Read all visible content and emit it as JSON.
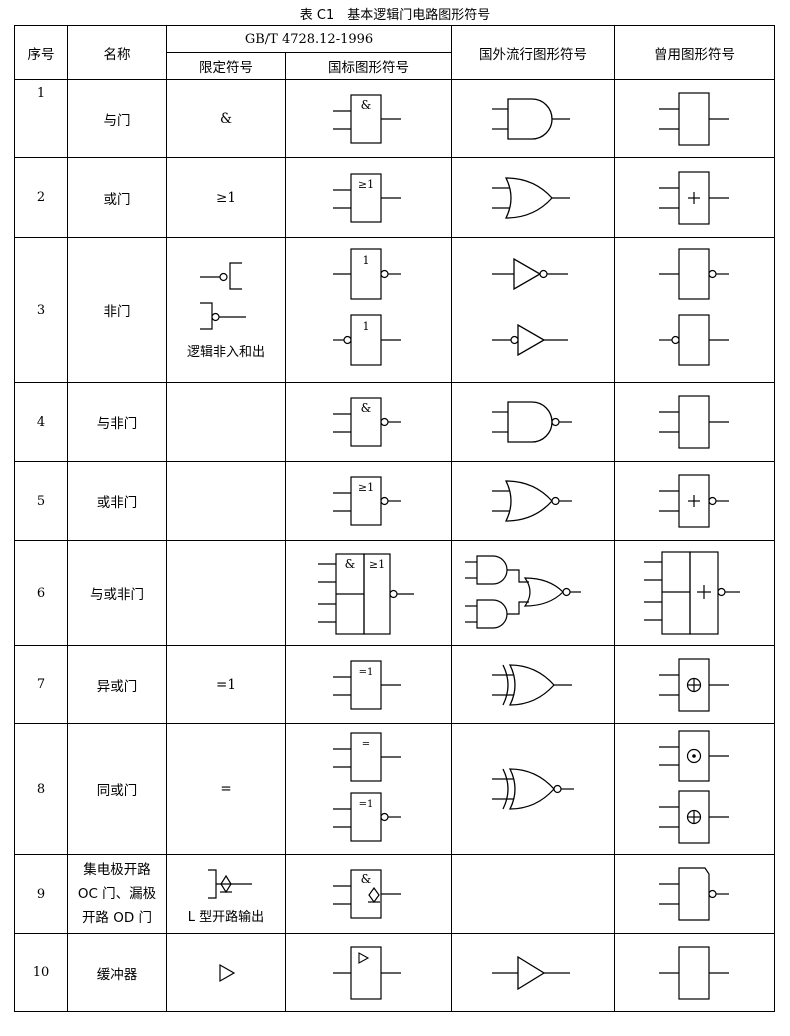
{
  "caption": "表 C1　基本逻辑门电路图形符号",
  "headers": {
    "index": "序号",
    "name": "名称",
    "standard": "GB/T 4728.12-1996",
    "qualifier": "限定符号",
    "national": "国标图形符号",
    "foreign": "国外流行图形符号",
    "legacy": "曾用图形符号"
  },
  "rows": [
    {
      "index": "1",
      "name": "与门",
      "qualifier": "&",
      "gb_label": "&"
    },
    {
      "index": "2",
      "name": "或门",
      "qualifier": "≥1",
      "gb_label": "≥1"
    },
    {
      "index": "3",
      "name": "非门",
      "qualifier_caption": "逻辑非入和出",
      "gb_label": "1"
    },
    {
      "index": "4",
      "name": "与非门",
      "gb_label": "&"
    },
    {
      "index": "5",
      "name": "或非门",
      "gb_label": "≥1"
    },
    {
      "index": "6",
      "name": "与或非门",
      "gb_label_left": "&",
      "gb_label_right": "≥1"
    },
    {
      "index": "7",
      "name": "异或门",
      "qualifier": "=1",
      "gb_label": "=1"
    },
    {
      "index": "8",
      "name": "同或门",
      "qualifier": "=",
      "gb_label_top": "=",
      "gb_label_bottom": "=1"
    },
    {
      "index": "9",
      "name_lines": [
        "集电极开路",
        "OC 门、漏极",
        "开路 OD 门"
      ],
      "qualifier_caption": "L 型开路输出",
      "gb_label": "&"
    },
    {
      "index": "10",
      "name": "缓冲器"
    }
  ]
}
